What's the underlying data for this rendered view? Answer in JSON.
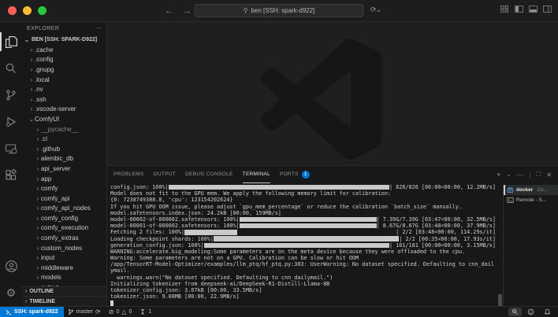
{
  "titlebar": {
    "search_text": "ben [SSH: spark-d922]"
  },
  "sidebar": {
    "title": "EXPLORER",
    "section": "BEN [SSH: SPARK-D922]",
    "tree": [
      {
        "label": ".cache",
        "depth": 1,
        "expanded": false
      },
      {
        "label": ".config",
        "depth": 1,
        "expanded": false
      },
      {
        "label": ".gnupg",
        "depth": 1,
        "expanded": false
      },
      {
        "label": ".local",
        "depth": 1,
        "expanded": false
      },
      {
        "label": ".nv",
        "depth": 1,
        "expanded": false
      },
      {
        "label": ".ssh",
        "depth": 1,
        "expanded": false
      },
      {
        "label": ".vscode-server",
        "depth": 1,
        "expanded": false
      },
      {
        "label": "ComfyUI",
        "depth": 1,
        "expanded": true
      },
      {
        "label": "__pycache__",
        "depth": 2,
        "expanded": false,
        "dim": true
      },
      {
        "label": ".ci",
        "depth": 2,
        "expanded": false
      },
      {
        "label": ".github",
        "depth": 2,
        "expanded": false
      },
      {
        "label": "alembic_db",
        "depth": 2,
        "expanded": false
      },
      {
        "label": "api_server",
        "depth": 2,
        "expanded": false
      },
      {
        "label": "app",
        "depth": 2,
        "expanded": false
      },
      {
        "label": "comfy",
        "depth": 2,
        "expanded": false
      },
      {
        "label": "comfy_api",
        "depth": 2,
        "expanded": false
      },
      {
        "label": "comfy_api_nodes",
        "depth": 2,
        "expanded": false
      },
      {
        "label": "comfy_config",
        "depth": 2,
        "expanded": false
      },
      {
        "label": "comfy_execution",
        "depth": 2,
        "expanded": false
      },
      {
        "label": "comfy_extras",
        "depth": 2,
        "expanded": false
      },
      {
        "label": "custom_nodes",
        "depth": 2,
        "expanded": false
      },
      {
        "label": "input",
        "depth": 2,
        "expanded": false
      },
      {
        "label": "middleware",
        "depth": 2,
        "expanded": false
      },
      {
        "label": "models",
        "depth": 2,
        "expanded": false
      },
      {
        "label": "output",
        "depth": 2,
        "expanded": false
      }
    ],
    "outline": "OUTLINE",
    "timeline": "TIMELINE"
  },
  "panel": {
    "tabs": [
      {
        "label": "PROBLEMS",
        "active": false
      },
      {
        "label": "OUTPUT",
        "active": false
      },
      {
        "label": "DEBUG CONSOLE",
        "active": false
      },
      {
        "label": "TERMINAL",
        "active": true
      },
      {
        "label": "PORTS",
        "active": false,
        "badge": "1"
      }
    ]
  },
  "terminal": {
    "lines": [
      {
        "l": "config.json: 100%|",
        "bar": "fill",
        "r": "| 826/826 [00:00<00:00, 12.2MB/s]"
      },
      {
        "l": "Model does not fit to the GPU mem. We apply the following memory limit for calibration:"
      },
      {
        "l": "{0: 7238749388.8, 'cpu': 123154202624}"
      },
      {
        "l": "If you hit GPU OOM issue, please adjust `gpu_mem_percentage` or reduce the calibration `batch_size` manually."
      },
      {
        "l": "model.safetensors.index.json: 24.2kB [00:00, 159MB/s]"
      },
      {
        "l": "model-00002-of-000002.safetensors: 100%|",
        "bar": "fill",
        "r": "| 7.39G/7.39G [03:47<00:00, 32.5MB/s]"
      },
      {
        "l": "model-00001-of-000002.safetensors: 100%|",
        "bar": "fill",
        "r": "| 8.67G/8.67G [03:48<00:00, 37.9MB/s]"
      },
      {
        "l": "Fetching 2 files: 100%|",
        "bar": 67,
        "gap": true,
        "r": "| 2/2 [03:48<00:00, 114.29s/it]"
      },
      {
        "l": "Loading checkpoint shards: 100%|",
        "bar": "fill",
        "r": "| 2/2 [00:35<00:00, 17.93s/it]"
      },
      {
        "l": "generation_config.json: 100%|",
        "bar": "fill",
        "r": "| 181/181 [00:00<00:00, 3.15MB/s]"
      },
      {
        "l": "WARNING:accelerate.big_modeling:Some parameters are on the meta device because they were offloaded to the cpu."
      },
      {
        "l": "Warning: Some parameters are not on a GPU. Calibration can be slow or hit OOM"
      },
      {
        "l": "/app/TensorRT-Model-Optimizer/examples/llm_ptq/hf_ptq.py:303: UserWarning: No dataset specified. Defaulting to cnn_dail"
      },
      {
        "l": "ymail."
      },
      {
        "l": "  warnings.warn(\"No dataset specified. Defaulting to cnn_dailymail.\")"
      },
      {
        "l": "Initializing tokenizer from deepseek-ai/DeepSeek-R1-Distill-Llama-8B"
      },
      {
        "l": "tokenizer_config.json: 3.07kB [00:00, 33.5MB/s]"
      },
      {
        "l": "tokenizer.json: 9.08MB [00:00, 22.9MB/s]"
      },
      {
        "cursor": true
      }
    ]
  },
  "terminal_list": {
    "items": [
      {
        "name": "docker",
        "desc": "Co...",
        "selected": true,
        "icon": "container-icon"
      },
      {
        "name": "Remote - S...",
        "desc": "",
        "selected": false,
        "icon": "terminal-icon"
      }
    ]
  },
  "status_bar": {
    "remote": "SSH: spark-d922",
    "branch": "master",
    "errors": "0",
    "warnings": "0",
    "ports": "1"
  },
  "colors": {
    "accent_blue": "#0078d4",
    "progress_bar": "#c9c9c9",
    "traffic_red": "#ff5f57",
    "traffic_yellow": "#febc2e",
    "traffic_green": "#28c840"
  }
}
